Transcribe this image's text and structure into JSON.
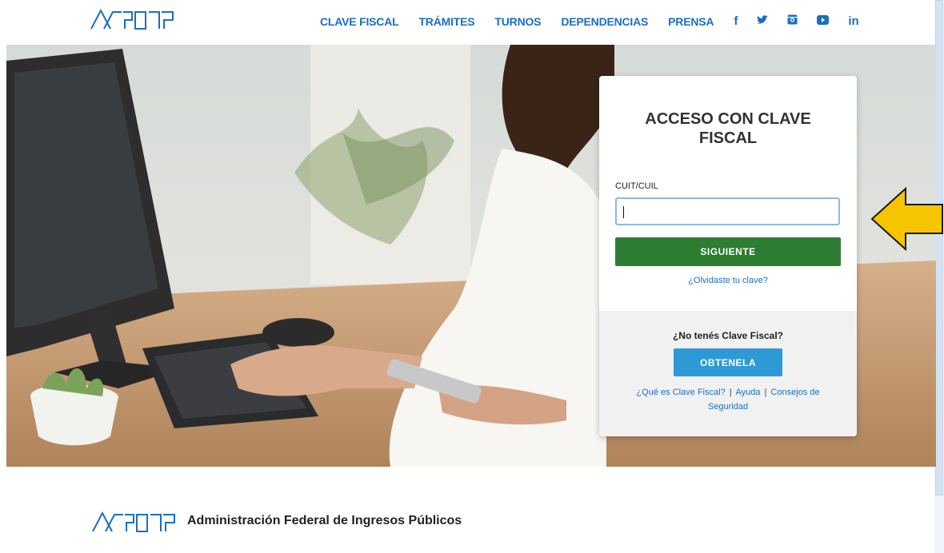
{
  "header": {
    "logo_alt": "AFIP",
    "nav": [
      "CLAVE FISCAL",
      "TRÁMITES",
      "TURNOS",
      "DEPENDENCIAS",
      "PRENSA"
    ],
    "social": [
      {
        "icon": "facebook-icon",
        "glyph": "f"
      },
      {
        "icon": "twitter-icon",
        "glyph": "🐦"
      },
      {
        "icon": "instagram-icon",
        "glyph": "◙"
      },
      {
        "icon": "youtube-icon",
        "glyph": "▶"
      },
      {
        "icon": "linkedin-icon",
        "glyph": "in"
      }
    ]
  },
  "login": {
    "title": "ACCESO CON CLAVE FISCAL",
    "cuit_label": "CUIT/CUIL",
    "cuit_value": "",
    "next_button": "SIGUIENTE",
    "forgot_link": "¿Olvidaste tu clave?",
    "no_key_text": "¿No tenés Clave Fiscal?",
    "get_button": "OBTENELA",
    "link_what": "¿Qué es Clave Fiscal?",
    "link_help": "Ayuda",
    "link_security": "Consejos de Seguridad"
  },
  "footer": {
    "org_name": "Administración Federal de Ingresos Públicos"
  },
  "colors": {
    "brand_blue": "#1b6ec2",
    "next_green": "#2d7d32",
    "get_blue": "#2d9ad6",
    "arrow_yellow": "#f6c500"
  }
}
